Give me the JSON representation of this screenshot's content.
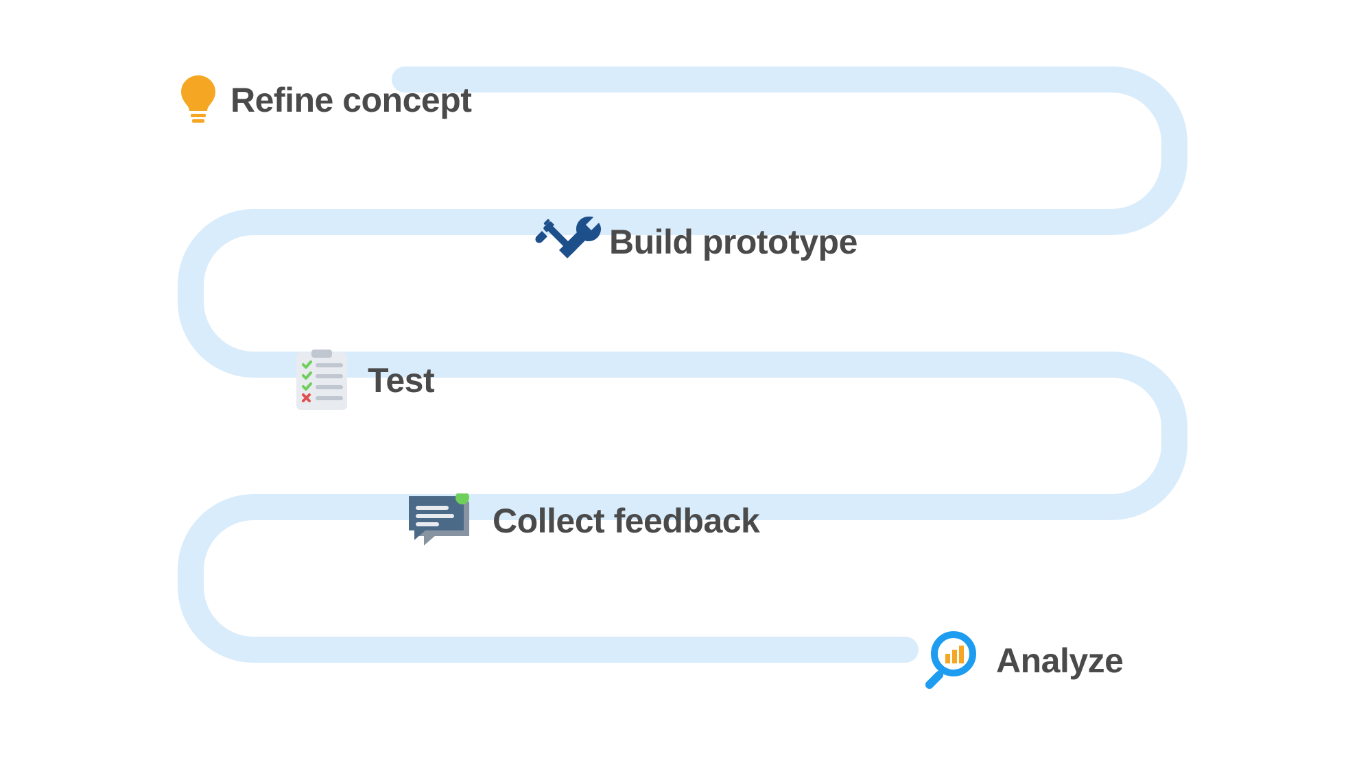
{
  "steps": [
    {
      "label": "Refine concept",
      "icon": "lightbulb-icon"
    },
    {
      "label": "Build prototype",
      "icon": "tools-icon"
    },
    {
      "label": "Test",
      "icon": "checklist-icon"
    },
    {
      "label": "Collect feedback",
      "icon": "comment-icon"
    },
    {
      "label": "Analyze",
      "icon": "magnify-chart-icon"
    }
  ],
  "colors": {
    "path": "#d9ecfb",
    "text": "#4a4a4a",
    "orange": "#f5a623",
    "navy": "#1d4f8b",
    "green": "#6fcf5b",
    "red": "#e04f4f",
    "grey1": "#e8ebef",
    "grey2": "#c0c7d1",
    "grey3": "#8893a2",
    "slate": "#4b6a88",
    "blue": "#1e9cf0"
  }
}
